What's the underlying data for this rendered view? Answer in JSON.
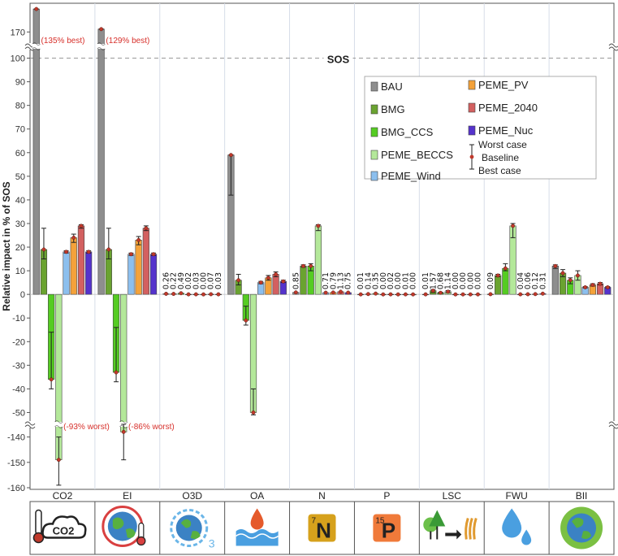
{
  "chart_data": {
    "type": "bar",
    "ylabel": "Relative impact in % of SOS",
    "sos_label": "SOS",
    "sos_value": 100,
    "ylim": [
      -160,
      180
    ],
    "axis_breaks": [
      [
        -55,
        -135
      ],
      [
        105,
        165
      ]
    ],
    "yticks": [
      -160,
      -150,
      -140,
      -50,
      -40,
      -30,
      -20,
      -10,
      0,
      10,
      20,
      30,
      40,
      50,
      60,
      70,
      80,
      90,
      100,
      170
    ],
    "categories": [
      "CO2",
      "EI",
      "O3D",
      "OA",
      "N",
      "P",
      "LSC",
      "FWU",
      "BII"
    ],
    "series": [
      {
        "name": "BAU",
        "color": "#8e8e8e",
        "values": [
          178,
          171,
          0.26,
          59,
          0.85,
          0.01,
          0.01,
          0.09,
          12
        ],
        "err_low": [
          178,
          171,
          null,
          42,
          null,
          null,
          null,
          null,
          11
        ],
        "err_high": [
          178,
          171,
          null,
          59,
          null,
          null,
          null,
          null,
          12.5
        ]
      },
      {
        "name": "BMG",
        "color": "#6aa330",
        "values": [
          19,
          19,
          0.22,
          6,
          12,
          0.14,
          1.57,
          8,
          9
        ],
        "err_low": [
          15,
          15,
          null,
          4,
          11.5,
          null,
          0.8,
          7.5,
          7.5
        ],
        "err_high": [
          28,
          28,
          null,
          8.5,
          12.5,
          null,
          2,
          8.5,
          10.5
        ]
      },
      {
        "name": "BMG_CCS",
        "color": "#55cc22",
        "values": [
          -36,
          -33,
          0.49,
          -11,
          12,
          0.35,
          0.68,
          11,
          6
        ],
        "err_low": [
          -40,
          -37,
          null,
          -13,
          10,
          null,
          0.5,
          10,
          4.5
        ],
        "err_high": [
          -16,
          -14,
          null,
          -5,
          13,
          null,
          0.9,
          13,
          7
        ]
      },
      {
        "name": "PEME_BECCS",
        "color": "#b4e89a",
        "values": [
          -149,
          -138,
          0.02,
          -50,
          29,
          0.0,
          1.14,
          29,
          8
        ],
        "err_low": [
          -159,
          -149,
          null,
          -51,
          27,
          null,
          0.7,
          24,
          6
        ],
        "err_high": [
          -140,
          -135,
          null,
          -40,
          29.5,
          null,
          1.6,
          30,
          10
        ]
      },
      {
        "name": "PEME_Wind",
        "color": "#8cbfee",
        "values": [
          18,
          17,
          0.03,
          5,
          0.71,
          0.02,
          0.0,
          0.04,
          3
        ],
        "err_low": [
          17.5,
          16.5,
          null,
          4.5,
          null,
          null,
          null,
          null,
          2.7
        ],
        "err_high": [
          18.5,
          17.5,
          null,
          5.5,
          null,
          null,
          null,
          null,
          3.3
        ]
      },
      {
        "name": "PEME_PV",
        "color": "#f4a23a",
        "values": [
          24,
          23,
          0.0,
          7,
          0.79,
          0.0,
          0.0,
          0.06,
          4
        ],
        "err_low": [
          22,
          21,
          null,
          6,
          null,
          null,
          null,
          null,
          3.5
        ],
        "err_high": [
          25.5,
          24.5,
          null,
          8,
          null,
          null,
          null,
          null,
          4.5
        ]
      },
      {
        "name": "PEME_2040",
        "color": "#d36060",
        "values": [
          29,
          28,
          0.07,
          8.5,
          1.13,
          0.01,
          0.0,
          0.12,
          4.5
        ],
        "err_low": [
          28,
          27,
          null,
          7.5,
          null,
          null,
          null,
          null,
          4
        ],
        "err_high": [
          29.5,
          29,
          null,
          9.5,
          null,
          null,
          null,
          null,
          5
        ]
      },
      {
        "name": "PEME_Nuc",
        "color": "#5533cc",
        "values": [
          18,
          17,
          0.03,
          5.5,
          0.75,
          0.0,
          0.0,
          0.31,
          3
        ],
        "err_low": [
          17.5,
          16.5,
          null,
          5,
          null,
          null,
          null,
          null,
          2.7
        ],
        "err_high": [
          18.5,
          17.5,
          null,
          6,
          null,
          null,
          null,
          null,
          3.3
        ]
      }
    ],
    "value_labels": {
      "O3D": [
        "0.26",
        "0.22",
        "0.49",
        "0.02",
        "0.03",
        "0.00",
        "0.07",
        "0.03"
      ],
      "N": [
        "0.85",
        "",
        "",
        "",
        "0.71",
        "0.79",
        "1.13",
        "0.75"
      ],
      "P": [
        "0.01",
        "0.14",
        "0.35",
        "0.00",
        "0.02",
        "0.00",
        "0.01",
        "0.00"
      ],
      "LSC": [
        "0.01",
        "1.57",
        "0.68",
        "1.14",
        "0.00",
        "0.00",
        "0.00",
        "0.00"
      ],
      "FWU": [
        "0.09",
        "",
        "",
        "",
        "0.04",
        "0.06",
        "0.12",
        "0.31"
      ]
    },
    "annotations": [
      {
        "category": "CO2",
        "text": "(135% best)",
        "y": 103
      },
      {
        "category": "EI",
        "text": "(129% best)",
        "y": 103
      },
      {
        "category": "CO2",
        "text": "(-93% worst)",
        "y": -53
      },
      {
        "category": "EI",
        "text": "(-86% worst)",
        "y": -53
      }
    ],
    "legend": {
      "placement": "upper-middle",
      "items": [
        "BAU",
        "PEME_PV",
        "BMG",
        "PEME_2040",
        "BMG_CCS",
        "PEME_Nuc",
        "PEME_BECCS",
        "PEME_Wind"
      ],
      "whisker_labels": [
        "Worst case",
        "Baseline",
        "Best case"
      ]
    },
    "icons": [
      "thermometer-cloud-co2-icon",
      "globe-thermometer-icon",
      "ozone-globe-icon",
      "ocean-drop-icon",
      "nitrogen-tile-icon",
      "phosphorus-tile-icon",
      "land-trees-crops-icon",
      "water-drops-icon",
      "biodiversity-globe-icon"
    ],
    "tile_text": {
      "N": {
        "super": "7",
        "symbol": "N"
      },
      "P": {
        "super": "15",
        "symbol": "P"
      },
      "CO2": "CO2",
      "O3": "3"
    }
  }
}
